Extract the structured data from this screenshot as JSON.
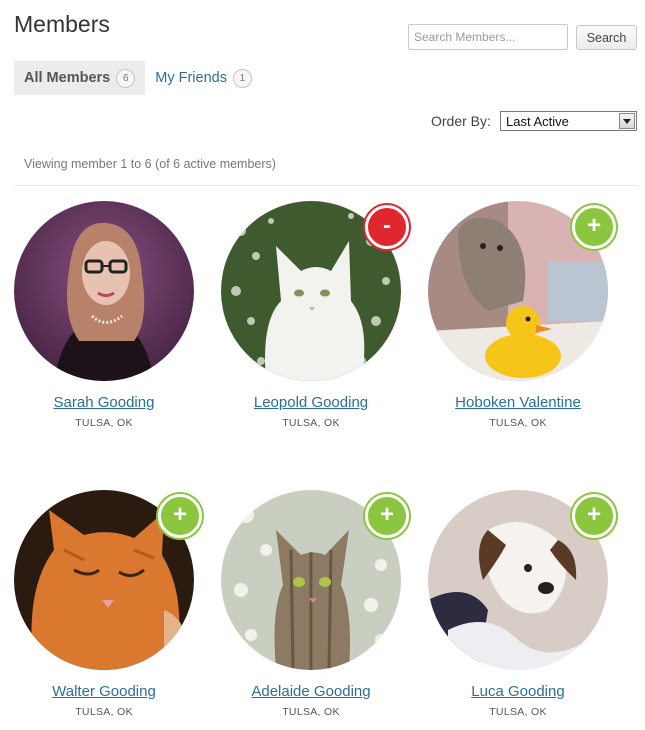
{
  "page": {
    "title": "Members"
  },
  "search": {
    "placeholder": "Search Members...",
    "button_label": "Search"
  },
  "tabs": [
    {
      "label": "All Members",
      "count": "6",
      "active": true
    },
    {
      "label": "My Friends",
      "count": "1",
      "active": false
    }
  ],
  "order": {
    "label": "Order By:",
    "selected": "Last Active"
  },
  "viewing_text": "Viewing member 1 to 6 (of 6 active members)",
  "colors": {
    "link": "#2b6f99",
    "add": "#8cc63f",
    "remove": "#e0262f"
  },
  "members": [
    {
      "name": "Sarah Gooding",
      "location": "TULSA, OK",
      "action": "none"
    },
    {
      "name": "Leopold Gooding",
      "location": "TULSA, OK",
      "action": "remove",
      "action_label": "-"
    },
    {
      "name": "Hoboken Valentine",
      "location": "TULSA, OK",
      "action": "add",
      "action_label": "+"
    },
    {
      "name": "Walter Gooding",
      "location": "TULSA, OK",
      "action": "add",
      "action_label": "+"
    },
    {
      "name": "Adelaide Gooding",
      "location": "TULSA, OK",
      "action": "add",
      "action_label": "+"
    },
    {
      "name": "Luca Gooding",
      "location": "TULSA, OK",
      "action": "add",
      "action_label": "+"
    }
  ]
}
